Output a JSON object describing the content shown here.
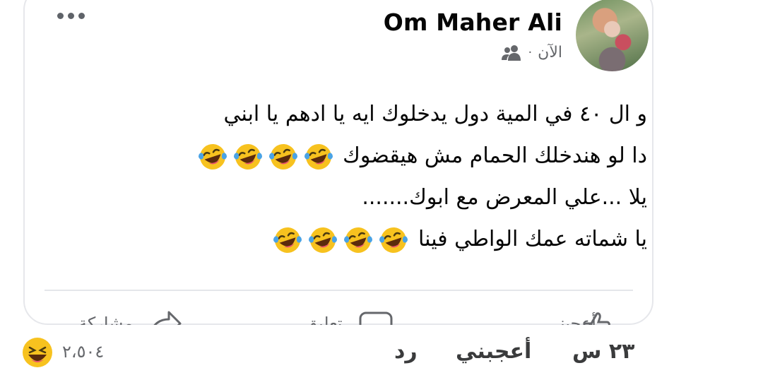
{
  "post": {
    "author": "Om Maher Ali",
    "time": "الآن",
    "separator": "·",
    "audience_icon": "friends-icon",
    "lines": [
      "و ال ٤٠ في المية دول يدخلوك ايه يا ادهم يا ابني",
      "دا لو هندخلك الحمام مش هيقضوك",
      "يلا ...علي المعرض مع ابوك.......",
      "يا شماته عمك الواطي فينا"
    ],
    "emoji": "laughing-crying-emoji",
    "line_emoji_counts": [
      0,
      4,
      0,
      4
    ]
  },
  "actions": {
    "like_label": "أعجبني",
    "comment_label": "تعليق",
    "share_label": "مشاركة"
  },
  "comment_footer": {
    "time": "٢٣ س",
    "like": "أعجبني",
    "reply": "رد",
    "reaction_count": "٢،٥٠٤",
    "reaction_icon": "haha-reaction-icon"
  },
  "colors": {
    "text": "#050505",
    "secondary": "#65676b",
    "border": "#e6e7eb",
    "emoji_face": "#f7c21f",
    "tears": "#4aa3e6"
  }
}
